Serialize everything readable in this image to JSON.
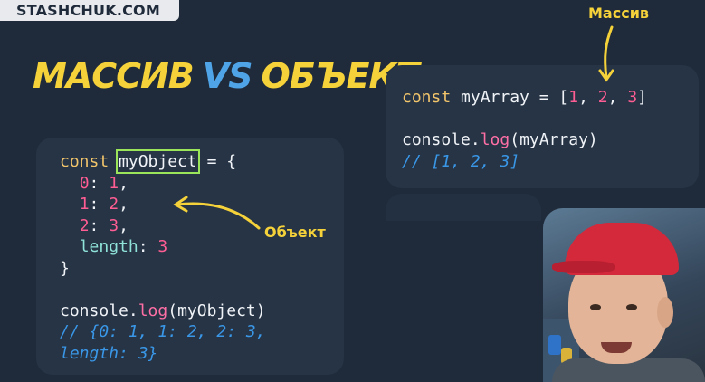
{
  "brand": {
    "logo_text": "STASHCHUK.COM"
  },
  "headline": {
    "part_a": "МАССИВ",
    "vs": "VS",
    "part_b": "ОБЪЕКТ"
  },
  "annotations": {
    "array_label": "Массив",
    "object_label": "Объект"
  },
  "colors": {
    "accent_yellow": "#f6d23a",
    "accent_blue": "#4fa4e8",
    "highlight_box": "#9be55a",
    "background": "#1f2b3a"
  },
  "left_code": {
    "l1_kw": "const",
    "l1_name": "myObject",
    "l1_rest": " = {",
    "l2_key": "0",
    "l2_val": "1",
    "l3_key": "1",
    "l3_val": "2",
    "l4_key": "2",
    "l4_val": "3",
    "l5_key": "length",
    "l5_val": "3",
    "l6": "}",
    "l8_obj": "console",
    "l8_fn": "log",
    "l8_arg": "myObject",
    "l9_comment": "// {0: 1, 1: 2, 2: 3,",
    "l10_comment": "length: 3}"
  },
  "right_code": {
    "l1_kw": "const",
    "l1_name": "myArray",
    "l1_eq": " = [",
    "v1": "1",
    "v2": "2",
    "v3": "3",
    "l3_obj": "console",
    "l3_fn": "log",
    "l3_arg": "myArray",
    "l4_comment": "// [1, 2, 3]"
  },
  "webcam": {
    "description_icon": "presenter-video-feed"
  }
}
